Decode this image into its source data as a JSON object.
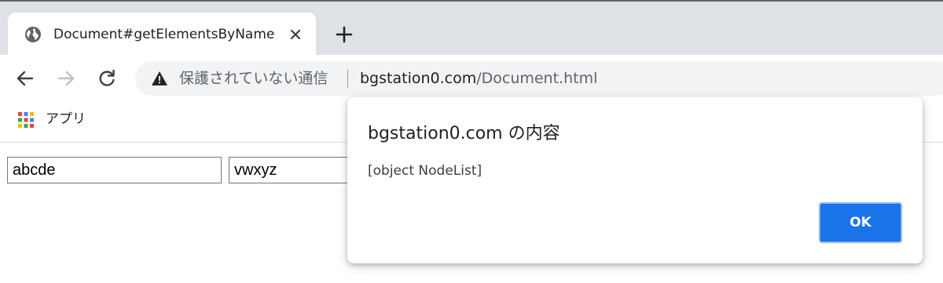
{
  "tab": {
    "title": "Document#getElementsByName",
    "favicon": "globe-icon",
    "close_icon": "close-icon",
    "new_tab_icon": "plus-icon"
  },
  "toolbar": {
    "back_icon": "back-arrow-icon",
    "forward_icon": "forward-arrow-icon",
    "reload_icon": "reload-icon"
  },
  "omnibox": {
    "warning_icon": "warning-triangle-icon",
    "security_text": "保護されていない通信",
    "url_host": "bgstation0.com",
    "url_path": "/Document.html"
  },
  "bookmarks": {
    "apps_icon": "apps-grid-icon",
    "apps_label": "アプリ"
  },
  "page": {
    "input1_value": "abcde",
    "input2_value": "vwxyz"
  },
  "dialog": {
    "title": "bgstation0.com の内容",
    "message": "[object NodeList]",
    "ok_label": "OK"
  },
  "colors": {
    "tabstrip": "#dee1e6",
    "omnibox": "#f1f3f4",
    "accent": "#1a73e8"
  }
}
